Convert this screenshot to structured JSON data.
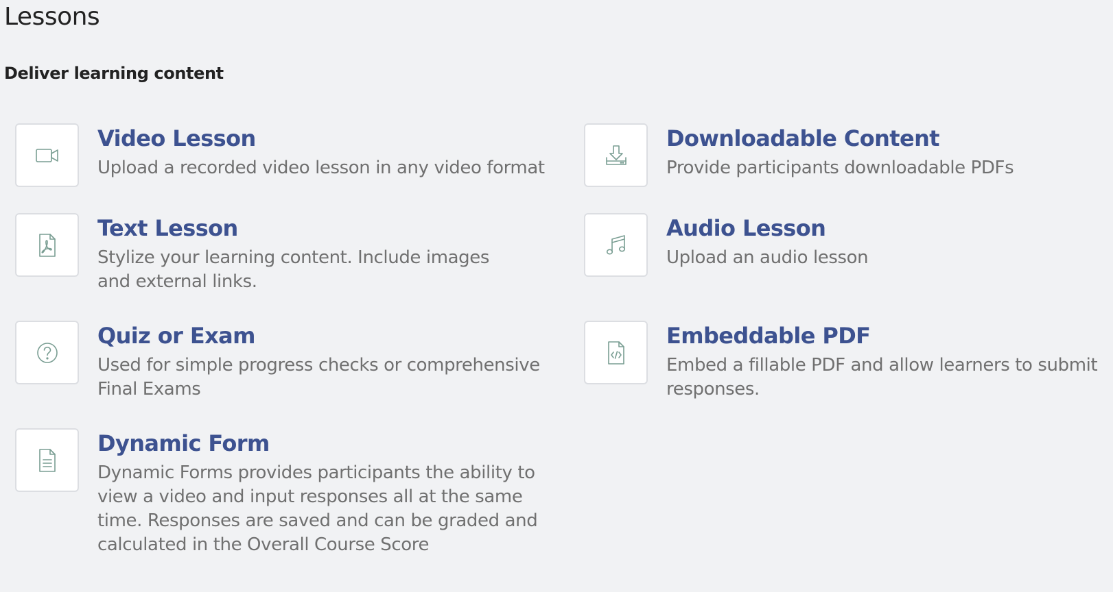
{
  "page": {
    "title": "Lessons",
    "subtitle": "Deliver learning content"
  },
  "lesson_types": [
    {
      "title": "Video Lesson",
      "description": "Upload a recorded video lesson in any video format",
      "icon": "video-camera-icon"
    },
    {
      "title": "Downloadable Content",
      "description": "Provide participants downloadable PDFs",
      "icon": "download-icon"
    },
    {
      "title": "Text Lesson",
      "description": "Stylize your learning content. Include images and external links.",
      "icon": "pdf-file-icon"
    },
    {
      "title": "Audio Lesson",
      "description": "Upload an audio lesson",
      "icon": "music-note-icon"
    },
    {
      "title": "Quiz or Exam",
      "description": "Used for simple progress checks or comprehensive Final Exams",
      "icon": "question-circle-icon"
    },
    {
      "title": "Embeddable PDF",
      "description": "Embed a fillable PDF and allow learners to submit responses.",
      "icon": "code-file-icon"
    },
    {
      "title": "Dynamic Form",
      "description": "Dynamic Forms provides participants the ability to view a video and input responses all at the same time. Responses are saved and can be graded and calculated in the Overall Course Score",
      "icon": "document-lines-icon"
    }
  ],
  "colors": {
    "background": "#f1f2f4",
    "title_link": "#3d5290",
    "description_text": "#707070",
    "icon_stroke": "#7a9e93",
    "icon_box_border": "#dcdee2"
  }
}
